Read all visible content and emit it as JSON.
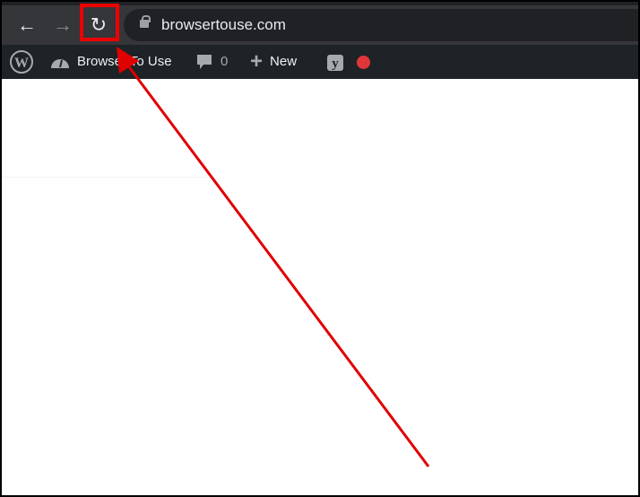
{
  "browser": {
    "url": "browsertouse.com",
    "back_icon": "arrow-left-icon",
    "forward_icon": "arrow-right-icon",
    "reload_icon": "reload-icon"
  },
  "admin_bar": {
    "site_name": "Browser To Use",
    "comments_count": "0",
    "new_label": "New",
    "record_color": "#e0363a"
  },
  "annotation": {
    "color": "#e00000",
    "target": "reload-button"
  }
}
